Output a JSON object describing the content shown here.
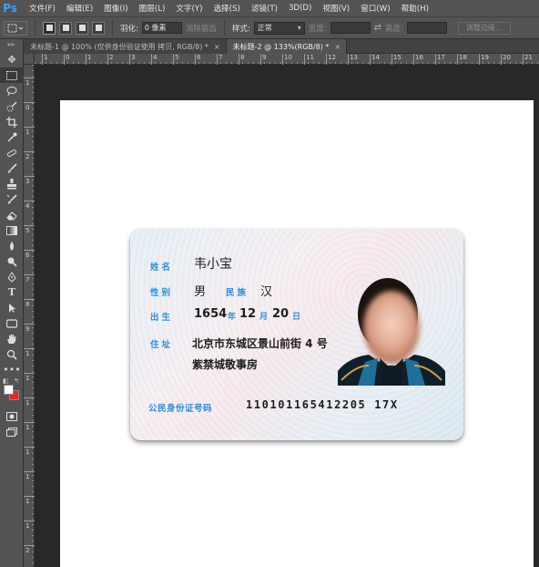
{
  "app": {
    "logo": "Ps"
  },
  "menu": [
    "文件(F)",
    "编辑(E)",
    "图像(I)",
    "图层(L)",
    "文字(Y)",
    "选择(S)",
    "滤镜(T)",
    "3D(D)",
    "视图(V)",
    "窗口(W)",
    "帮助(H)"
  ],
  "options": {
    "feather_label": "羽化:",
    "feather_value": "0 像素",
    "antialias_label": "消除锯齿",
    "style_label": "样式:",
    "style_value": "正常",
    "width_label": "宽度:",
    "height_label": "高度:",
    "refine_button": "调整边缘..."
  },
  "tabs": [
    {
      "label": "未标题-1 @ 100% (仅供身份验证使用 拷贝, RGB/8) *",
      "close": "×"
    },
    {
      "label": "未标题-2 @ 133%(RGB/8) *",
      "close": "×"
    }
  ],
  "ruler": {
    "h_labels": [
      "1",
      "0",
      "1",
      "2",
      "3",
      "4",
      "5",
      "6",
      "7",
      "8",
      "9",
      "10",
      "11",
      "12",
      "13",
      "14",
      "15",
      "16",
      "17",
      "18",
      "19",
      "20",
      "21",
      "22"
    ],
    "v_labels": [
      "1",
      "0",
      "1",
      "2",
      "3",
      "4",
      "5",
      "6",
      "7",
      "8",
      "9",
      "1",
      "1",
      "1",
      "1",
      "1",
      "1",
      "1",
      "1",
      "2"
    ]
  },
  "colors": {
    "foreground": "#ffffff",
    "background": "#e2282d",
    "accent": "#3aa1ff",
    "card_label": "#2f8ed4"
  },
  "id_card": {
    "name_label": "姓名",
    "name_value": "韦小宝",
    "gender_label": "性别",
    "gender_value": "男",
    "ethnicity_label": "民族",
    "ethnicity_value": "汉",
    "birth_label": "出生",
    "birth_year": "1654",
    "year_unit": "年",
    "birth_month": "12",
    "month_unit": "月",
    "birth_day": "20",
    "day_unit": "日",
    "address_label": "住址",
    "address_line1": "北京市东城区景山前街 4 号",
    "address_line2": "紫禁城敬事房",
    "id_label": "公民身份证号码",
    "id_number": "110101165412205 17X"
  }
}
